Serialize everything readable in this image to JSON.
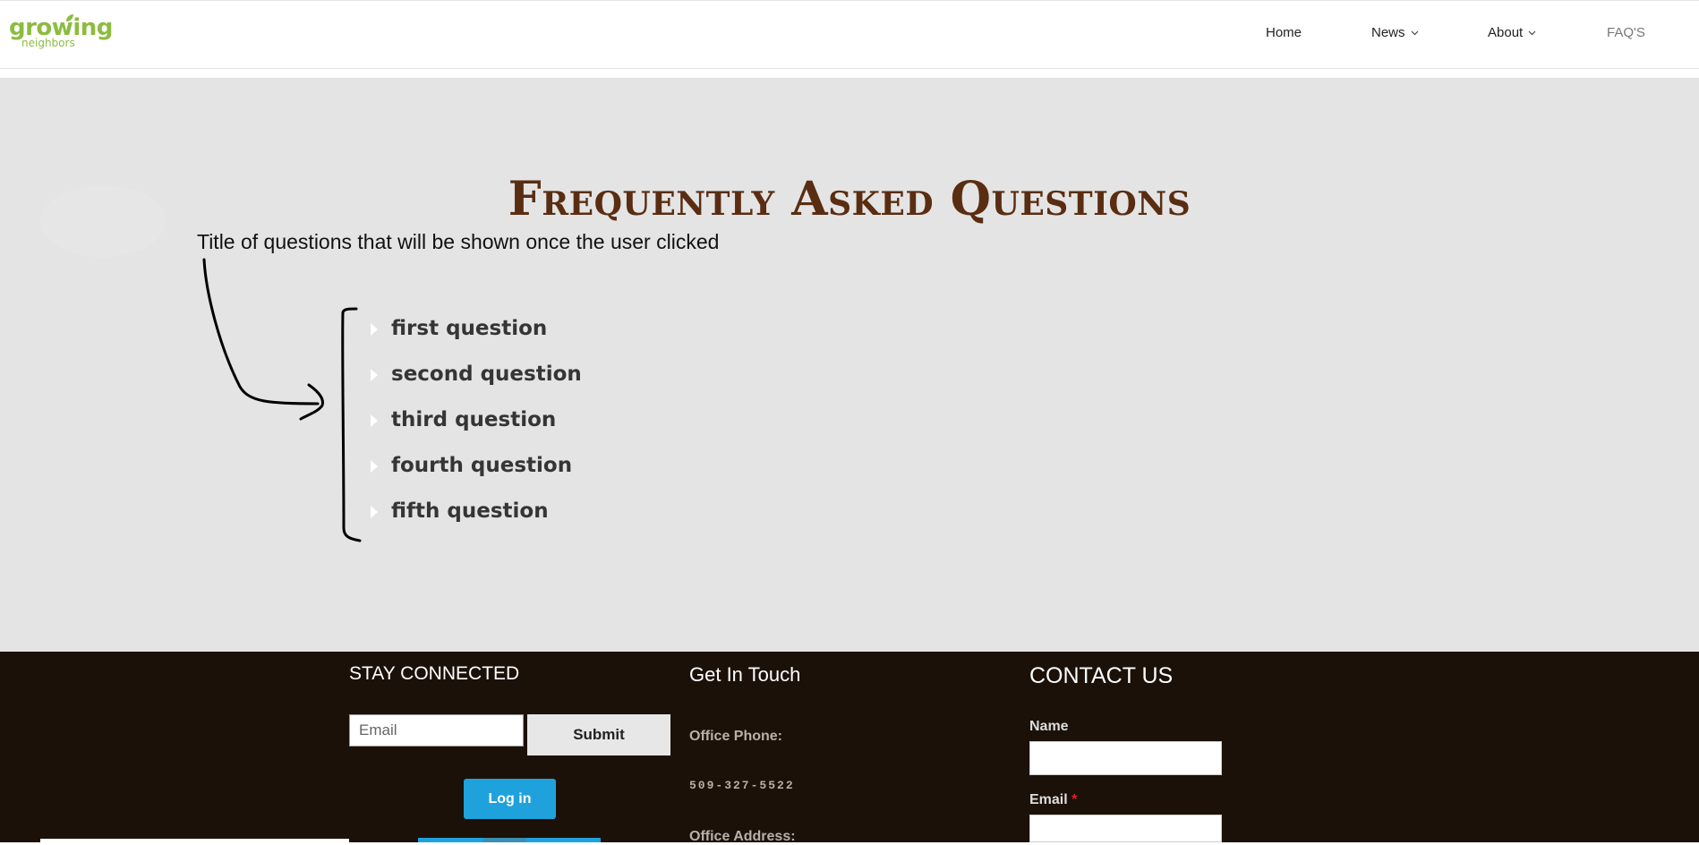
{
  "header": {
    "logo_main": "growing",
    "logo_sub": "neighbors",
    "nav": [
      {
        "label": "Home"
      },
      {
        "label": "News"
      },
      {
        "label": "About"
      },
      {
        "label": "FAQ'S"
      }
    ]
  },
  "main": {
    "title": "Frequently Asked Questions",
    "annotation": "Title of questions that will be shown once the user clicked",
    "questions": [
      {
        "label": "first question"
      },
      {
        "label": "second question"
      },
      {
        "label": "third question"
      },
      {
        "label": "fourth question"
      },
      {
        "label": "fifth question"
      }
    ]
  },
  "footer": {
    "stay_connected": "STAY CONNECTED",
    "email_placeholder": "Email",
    "submit_label": "Submit",
    "login_label": "Log in",
    "get_in_touch": "Get In Touch",
    "office_phone_label": "Office Phone:",
    "office_phone": "509-327-5522",
    "office_address_label": "Office Address:",
    "contact_us": "CONTACT US",
    "name_label": "Name",
    "email_label": "Email",
    "required_mark": "*"
  },
  "colors": {
    "logo_green": "#8cbc3f",
    "title_brown": "#5a2d12",
    "main_bg": "#e4e4e4",
    "footer_bg": "#1b1109",
    "login_blue": "#1fa2dc"
  },
  "icons": [
    "leaf-icon",
    "chevron-down-icon",
    "caret-right-icon",
    "arrow-annotation-icon",
    "bracket-annotation-icon"
  ]
}
